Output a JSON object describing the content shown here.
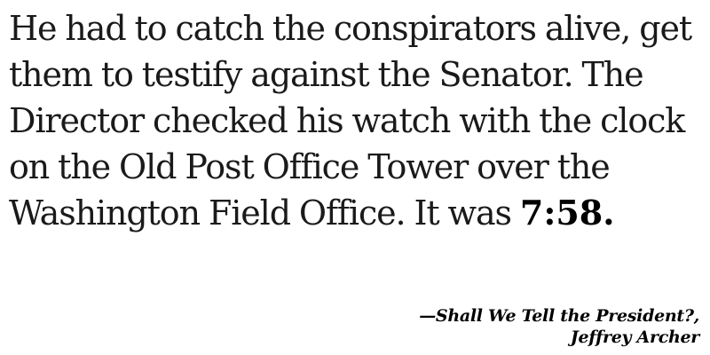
{
  "quote": {
    "lines": [
      "He had to catch the conspirators alive, get",
      "them to testify against the Senator. The",
      "Director checked his watch with the clock",
      "on the Old Post Office Tower over the"
    ],
    "last_line_prefix": "Washington Field Office. It was ",
    "time": "7:58."
  },
  "attribution": {
    "title_line": "—Shall We Tell the President?,",
    "author": "Jeffrey Archer"
  }
}
